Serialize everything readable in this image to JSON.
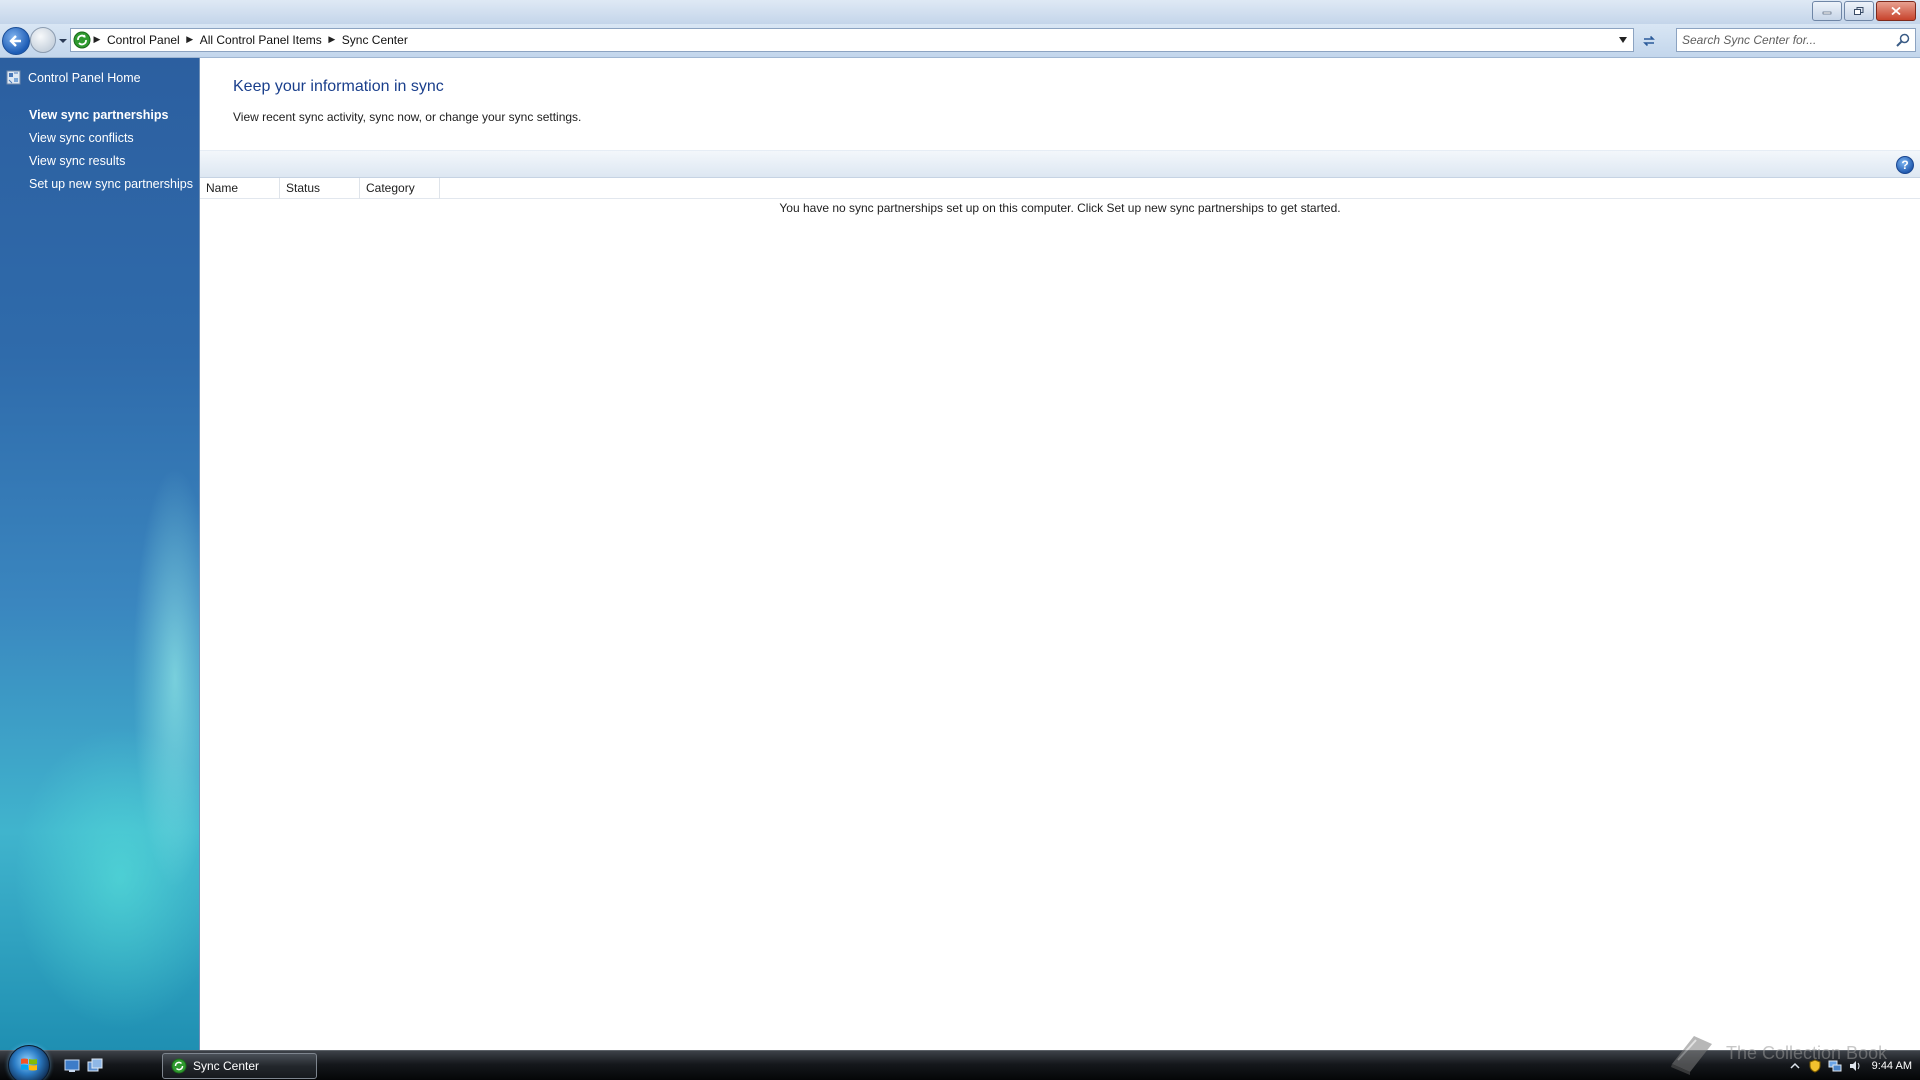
{
  "window": {
    "caption_buttons": [
      "minimize",
      "restore",
      "close"
    ]
  },
  "address_bar": {
    "breadcrumbs": [
      "Control Panel",
      "All Control Panel Items",
      "Sync Center"
    ],
    "search_placeholder": "Search Sync Center for..."
  },
  "left_pane": {
    "home_label": "Control Panel Home",
    "tasks": [
      {
        "label": "View sync partnerships",
        "active": true
      },
      {
        "label": "View sync conflicts",
        "active": false
      },
      {
        "label": "View sync results",
        "active": false
      },
      {
        "label": "Set up new sync partnerships",
        "active": false
      }
    ]
  },
  "main": {
    "title": "Keep your information in sync",
    "description": "View recent sync activity, sync now, or change your sync settings.",
    "columns": [
      "Name",
      "Status",
      "Category"
    ],
    "empty_message": "You have no sync partnerships set up on this computer. Click Set up new sync partnerships to get started."
  },
  "taskbar": {
    "open_window": "Sync Center",
    "clock": "9:44 AM",
    "watermark": "The Collection Book"
  },
  "colors": {
    "title_blue": "#1a3f8c",
    "pane_top": "#2c5fa0",
    "pane_bottom": "#40b4cd"
  }
}
